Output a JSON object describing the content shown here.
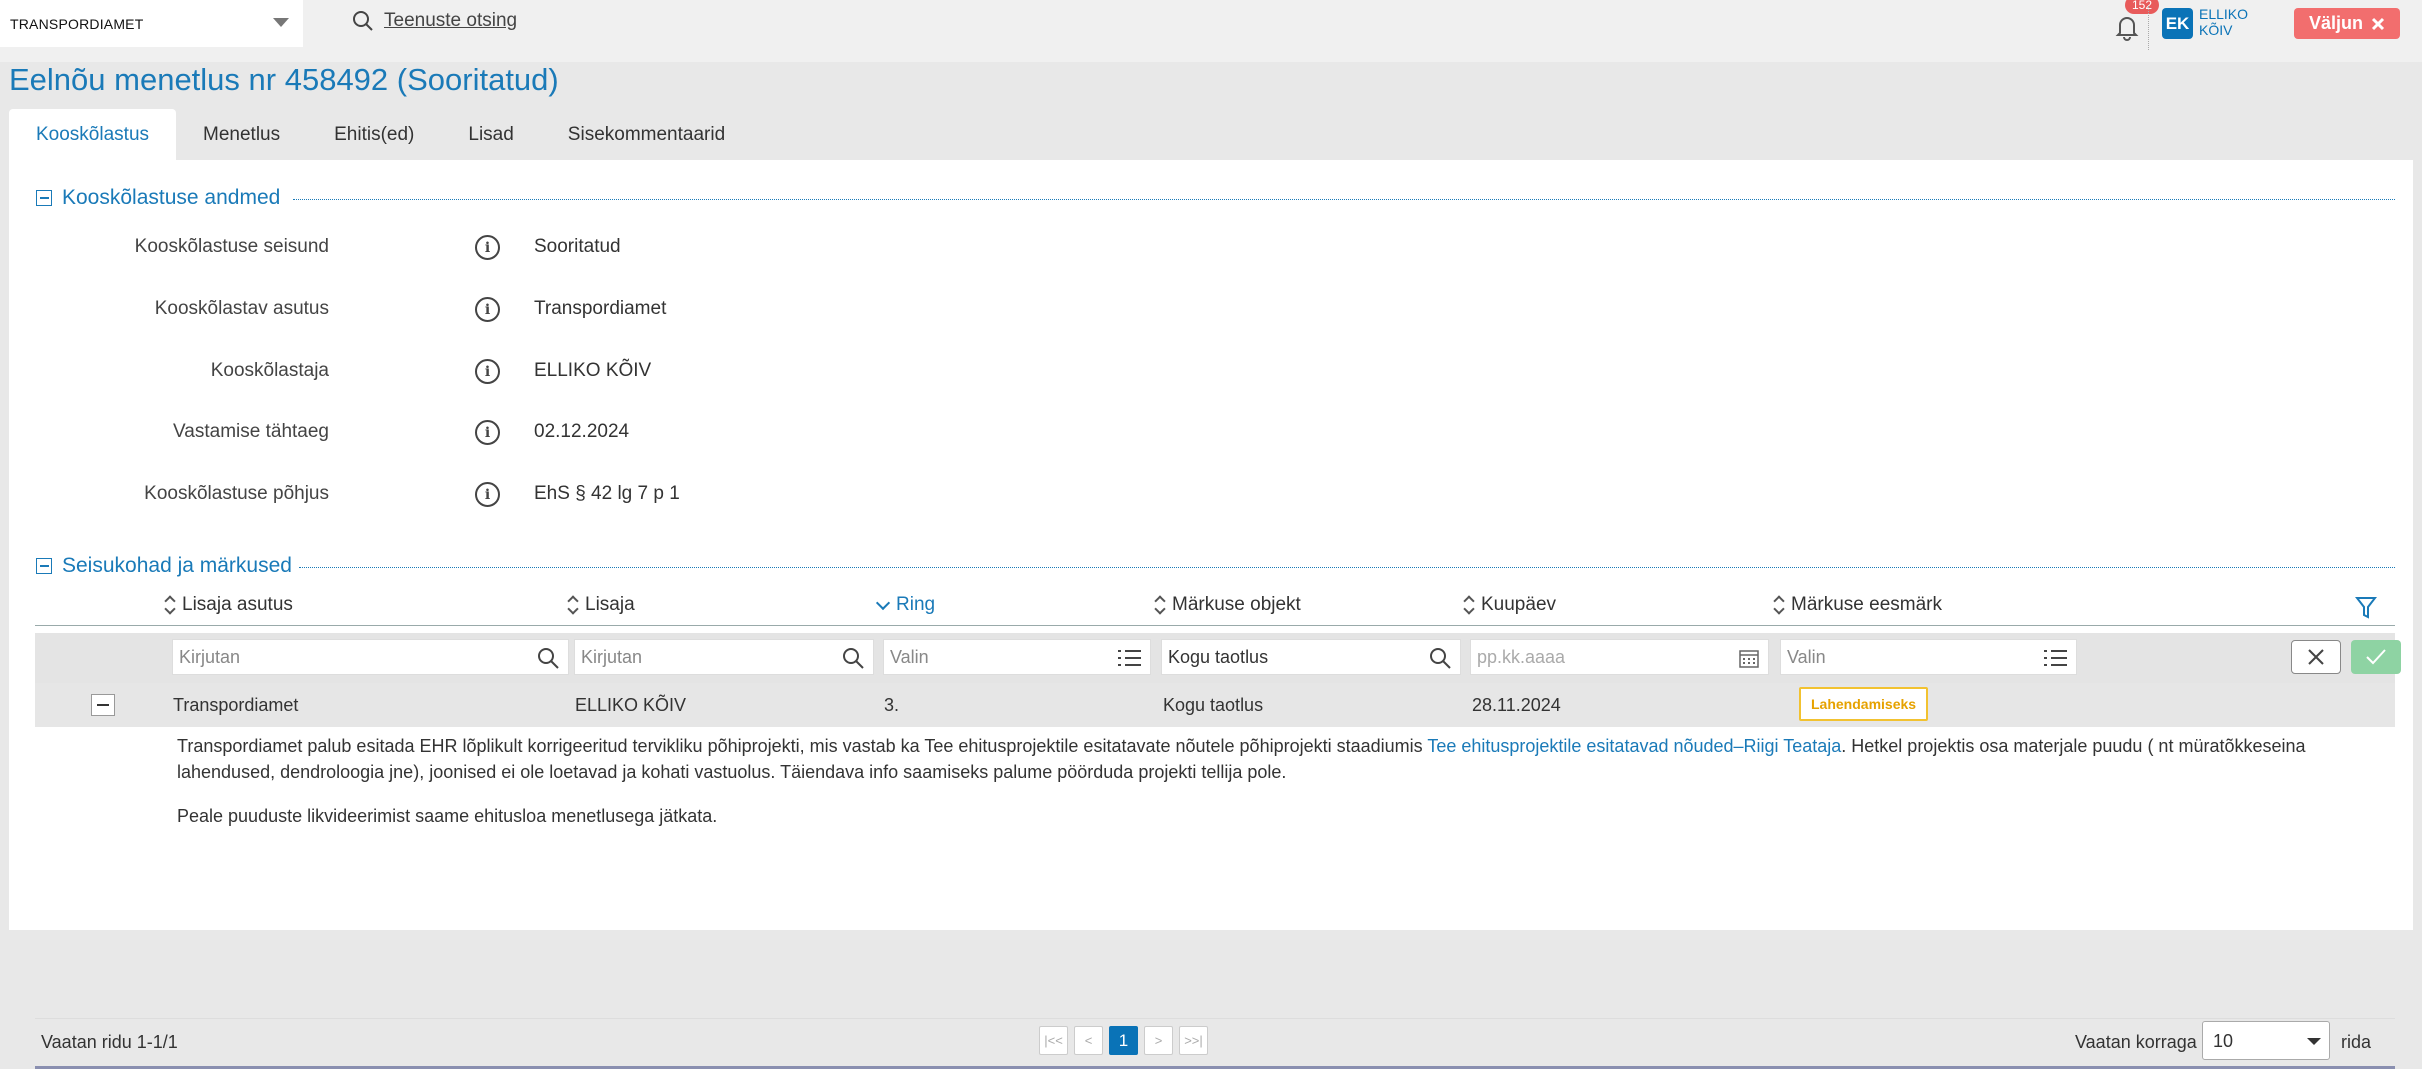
{
  "topbar": {
    "org_select": "TRANSPORDIAMET",
    "search_link": "Teenuste otsing",
    "notifications_count": "152",
    "user_initials": "EK",
    "user_first": "ELLIKO",
    "user_last": "KÕIV",
    "logout_label": "Väljun"
  },
  "page_title": "Eelnõu menetlus nr 458492 (Sooritatud)",
  "tabs": [
    {
      "label": "Kooskõlastus",
      "active": true
    },
    {
      "label": "Menetlus"
    },
    {
      "label": "Ehitis(ed)"
    },
    {
      "label": "Lisad"
    },
    {
      "label": "Sisekommentaarid"
    }
  ],
  "section1": {
    "title": "Kooskõlastuse andmed",
    "fields": [
      {
        "label": "Kooskõlastuse seisund",
        "value": "Sooritatud"
      },
      {
        "label": "Kooskõlastav asutus",
        "value": "Transpordiamet"
      },
      {
        "label": "Kooskõlastaja",
        "value": "ELLIKO KÕIV"
      },
      {
        "label": "Vastamise tähtaeg",
        "value": "02.12.2024"
      },
      {
        "label": "Kooskõlastuse põhjus",
        "value": "EhS § 42 lg 7 p 1"
      }
    ]
  },
  "section2": {
    "title": "Seisukohad ja märkused",
    "columns": [
      "Lisaja asutus",
      "Lisaja",
      "Ring",
      "Märkuse objekt",
      "Kuupäev",
      "Märkuse eesmärk"
    ],
    "filters": {
      "lisaja_asutus": "Kirjutan",
      "lisaja": "Kirjutan",
      "ring": "Valin",
      "objekt": "Kogu taotlus",
      "kuupaev": "pp.kk.aaaa",
      "eesmark": "Valin"
    },
    "row": {
      "asutus": "Transpordiamet",
      "lisaja": "ELLIKO KÕIV",
      "ring": "3.",
      "objekt": "Kogu taotlus",
      "kuupaev": "28.11.2024",
      "eesmark": "Lahendamiseks"
    },
    "detail": {
      "p1_start": "Transpordiamet palub esitada EHR lõplikult korrigeeritud tervikliku põhiprojekti, mis vastab ka Tee ehitusprojektile esitatavate nõutele põhiprojekti staadiumis ",
      "p1_link": "Tee ehitusprojektile esitatavad nõuded–Riigi Teataja",
      "p1_end": ". Hetkel projektis osa materjale puudu ( nt müratõkkeseina lahendused, dendroloogia jne), joonised ei ole loetavad ja kohati vastuolus. Täiendava info saamiseks palume pöörduda projekti tellija pole.",
      "p2": "Peale puuduste likvideerimist saame ehitusloa menetlusega jätkata."
    }
  },
  "footer": {
    "showing": "Vaatan ridu 1-1/1",
    "current_page": "1",
    "per_page_label": "Vaatan korraga",
    "per_page_value": "10",
    "rows_suffix": "rida"
  },
  "colors": {
    "accent": "#1a7ab8",
    "logout": "#f26e6e",
    "badge": "#f2c230"
  }
}
